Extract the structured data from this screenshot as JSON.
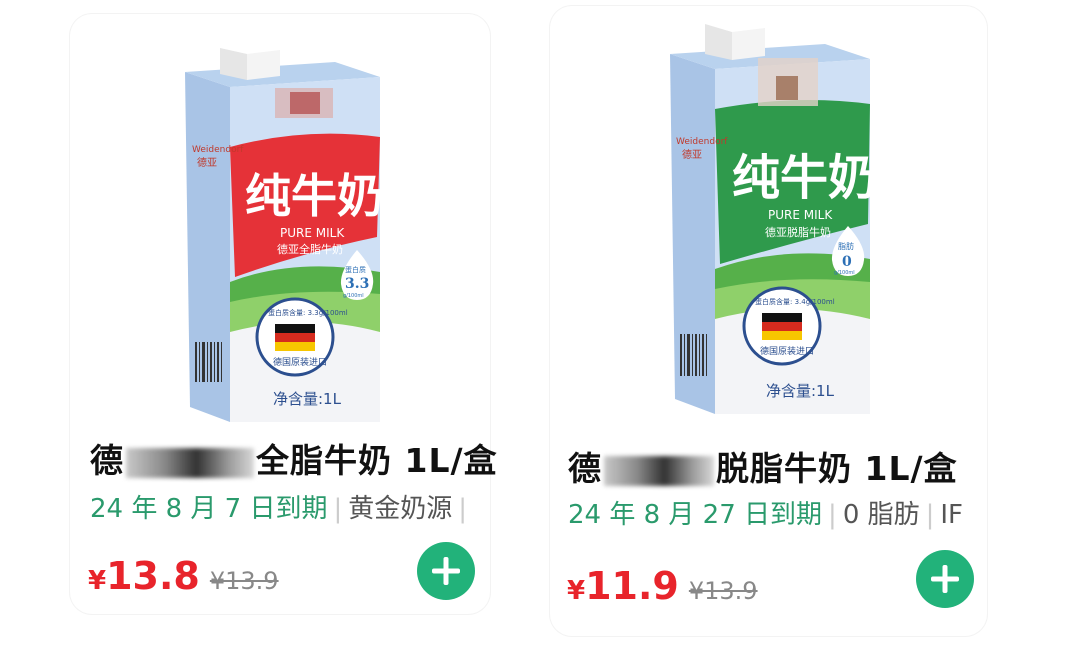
{
  "products": [
    {
      "title_prefix": "德",
      "title_suffix": "全脂牛奶 1L/盒",
      "expiry_label": "24 年 8 月 7 日到期",
      "tag": "黄金奶源",
      "tag_extra": "",
      "price_currency": "¥",
      "price": "13.8",
      "original_price": "¥13.9",
      "package": {
        "brand": "Weidendorf",
        "brand_cn": "德亚",
        "name": "纯牛奶",
        "english": "PURE MILK",
        "subtitle": "德亚全脂牛奶",
        "badge_label": "蛋白质",
        "badge_value": "3.3",
        "badge_unit": "g/100ml",
        "seal_text": "蛋白质含量: 3.3g/100ml",
        "seal_bottom": "德国原装进口",
        "volume": "净含量:1L",
        "accent_color": "#e53238"
      }
    },
    {
      "title_prefix": "德",
      "title_suffix": "脱脂牛奶 1L/盒",
      "expiry_label": "24 年 8 月 27 日到期",
      "tag": "0 脂肪",
      "tag_extra": "IF",
      "price_currency": "¥",
      "price": "11.9",
      "original_price": "¥13.9",
      "package": {
        "brand": "Weidendorf",
        "brand_cn": "德亚",
        "name": "纯牛奶",
        "english": "PURE MILK",
        "subtitle": "德亚脱脂牛奶",
        "badge_label": "脂肪",
        "badge_value": "0",
        "badge_unit": "g/100ml",
        "seal_text": "蛋白质含量: 3.4g/100ml",
        "seal_bottom": "德国原装进口",
        "volume": "净含量:1L",
        "accent_color": "#2f9a4c"
      }
    }
  ],
  "icons": {
    "add": "plus-circle-icon"
  }
}
